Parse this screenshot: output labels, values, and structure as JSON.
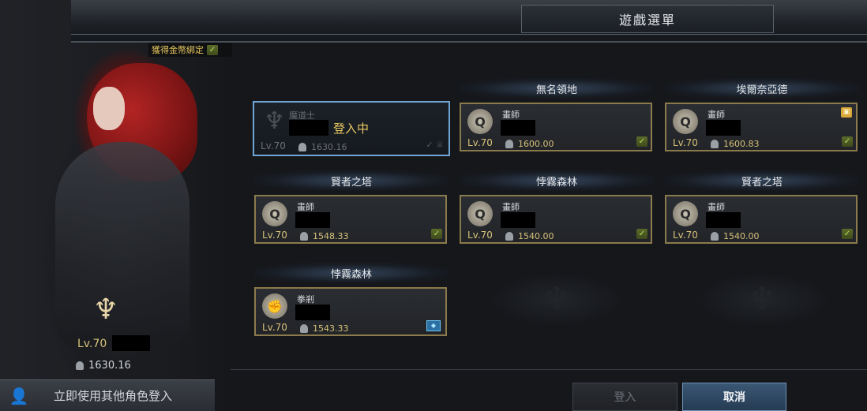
{
  "window": {
    "title": "遊戲選單"
  },
  "active_character": {
    "bound_gold_label": "獲得金幣綁定",
    "level": "Lv.70",
    "gear_score": "1630.16"
  },
  "switch_button_label": "立即使用其他角色登入",
  "groups": [
    {
      "header": "無名領地"
    },
    {
      "header": "埃爾奈亞德"
    },
    {
      "header": "賢者之塔"
    },
    {
      "header": "悖霧森林"
    },
    {
      "header": "賢者之塔"
    },
    {
      "header": "悖霧森林"
    }
  ],
  "characters": [
    {
      "class": "魔道士",
      "level": "Lv.70",
      "gear_score": "1630.16",
      "status": "登入中",
      "icon": "trident-icon"
    },
    {
      "class": "畫師",
      "level": "Lv.70",
      "gear_score": "1600.00",
      "icon": "artist-icon",
      "badge": "check-icon"
    },
    {
      "class": "畫師",
      "level": "Lv.70",
      "gear_score": "1600.83",
      "icon": "artist-icon",
      "badge": "check-icon",
      "extra": "gift-icon"
    },
    {
      "class": "畫師",
      "level": "Lv.70",
      "gear_score": "1548.33",
      "icon": "artist-icon",
      "badge": "check-icon"
    },
    {
      "class": "畫師",
      "level": "Lv.70",
      "gear_score": "1540.00",
      "icon": "artist-icon",
      "badge": "check-icon"
    },
    {
      "class": "畫師",
      "level": "Lv.70",
      "gear_score": "1540.00",
      "icon": "artist-icon",
      "badge": "check-icon"
    },
    {
      "class": "拳剎",
      "level": "Lv.70",
      "gear_score": "1543.33",
      "icon": "fist-icon",
      "badge": "crystal-icon"
    }
  ],
  "buttons": {
    "login": "登入",
    "cancel": "取消"
  }
}
